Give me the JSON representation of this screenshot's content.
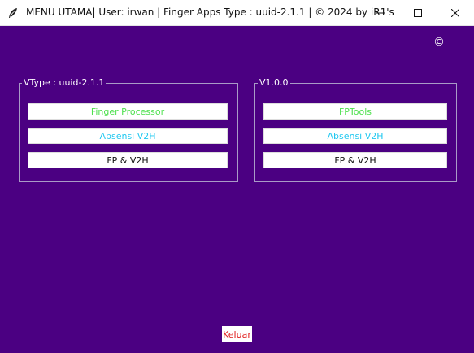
{
  "window": {
    "title": "MENU UTAMA| User: irwan | Finger Apps Type : uuid-2.1.1 | © 2024 by iR1's",
    "icons": {
      "app": "feather-icon",
      "minimize": "minimize-icon",
      "maximize": "maximize-icon",
      "close": "close-icon"
    }
  },
  "copyright_symbol": "©",
  "frame_left": {
    "label": "VType : uuid-2.1.1",
    "buttons": [
      {
        "label": "Finger Processor",
        "color": "#4ee04e"
      },
      {
        "label": "Absensi V2H",
        "color": "#22c8f0"
      },
      {
        "label": "FP & V2H",
        "color": "#111111"
      }
    ]
  },
  "frame_right": {
    "label": "V1.0.0",
    "buttons": [
      {
        "label": "FPTools",
        "color": "#4ee04e"
      },
      {
        "label": "Absensi V2H",
        "color": "#22c8f0"
      },
      {
        "label": "FP & V2H",
        "color": "#111111"
      }
    ]
  },
  "exit_button": {
    "label": "Keluar",
    "color": "#e01a1a"
  },
  "colors": {
    "background": "#4b0082",
    "frame_border": "#a99bc7"
  }
}
